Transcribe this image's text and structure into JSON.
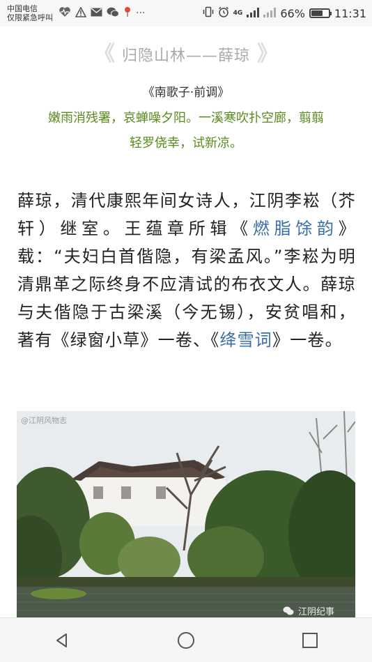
{
  "status_bar": {
    "carrier_line1": "中国电信",
    "carrier_line2": "仅限紧急呼叫",
    "left_icons": [
      "heart-pulse-icon",
      "warning-icon",
      "mail-icon",
      "wechat-icon",
      "pin-icon",
      "more-icon"
    ],
    "more": "···",
    "network": "4G",
    "battery": "66%",
    "battery_level": 0.66,
    "time": "11:31"
  },
  "article": {
    "title": "归隐山林——薛琼",
    "poem_title": "《南歌子·前调》",
    "poem_line1": "嫩雨消残署，哀蝉噪夕阳。一溪寒吹扑空廊，翦翦",
    "poem_line2": "轻罗侥幸，试新凉。",
    "body_p1": "薛琼，清代康熙年间女诗人，江阴李崧（芥轩）继室。王蕴章所辑《",
    "link1": "燃脂馀韵",
    "body_p2": "》载：“夫妇白首偕隐，有梁孟风。”李崧为明清鼎革之际终身不应清试的布衣文人。薛琼与夫偕隐于古梁溪（今无锡），安贫唱和，著有《绿窗小草》一卷、《",
    "link2": "绛雪词",
    "body_p3": "》一卷。"
  },
  "photo": {
    "watermark_top": "@江阴风物志",
    "watermark_bottom": "江阴纪事"
  },
  "colors": {
    "poem_green": "#5b8a1f",
    "link_blue": "#3a6ea8"
  }
}
